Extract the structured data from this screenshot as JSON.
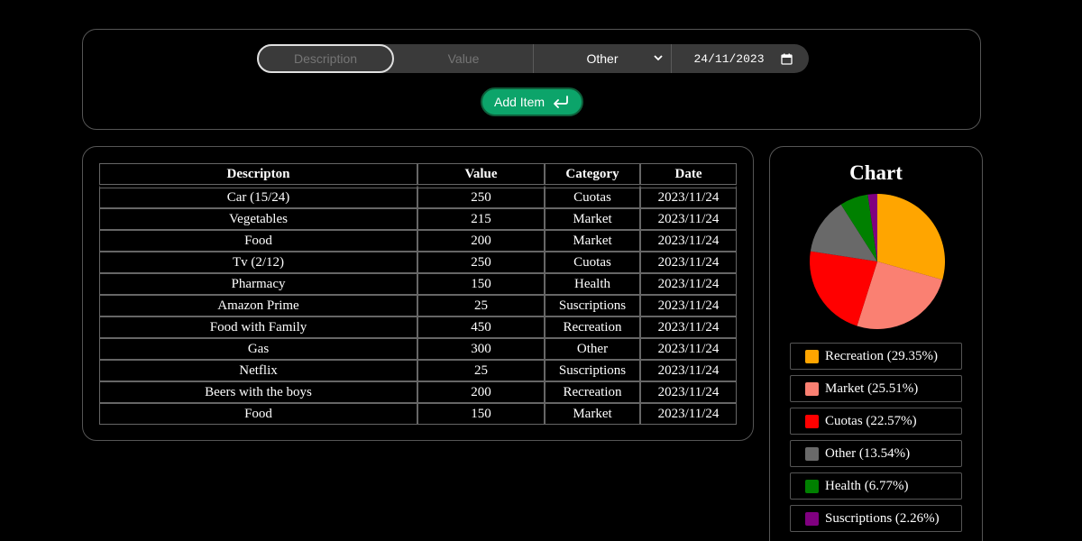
{
  "form": {
    "description_placeholder": "Description",
    "value_placeholder": "Value",
    "category_selected": "Other",
    "date_value": "24/11/2023",
    "add_button_label": "Add Item"
  },
  "table": {
    "headers": [
      "Descripton",
      "Value",
      "Category",
      "Date"
    ],
    "rows": [
      [
        "Car (15/24)",
        "250",
        "Cuotas",
        "2023/11/24"
      ],
      [
        "Vegetables",
        "215",
        "Market",
        "2023/11/24"
      ],
      [
        "Food",
        "200",
        "Market",
        "2023/11/24"
      ],
      [
        "Tv (2/12)",
        "250",
        "Cuotas",
        "2023/11/24"
      ],
      [
        "Pharmacy",
        "150",
        "Health",
        "2023/11/24"
      ],
      [
        "Amazon Prime",
        "25",
        "Suscriptions",
        "2023/11/24"
      ],
      [
        "Food with Family",
        "450",
        "Recreation",
        "2023/11/24"
      ],
      [
        "Gas",
        "300",
        "Other",
        "2023/11/24"
      ],
      [
        "Netflix",
        "25",
        "Suscriptions",
        "2023/11/24"
      ],
      [
        "Beers with the boys",
        "200",
        "Recreation",
        "2023/11/24"
      ],
      [
        "Food",
        "150",
        "Market",
        "2023/11/24"
      ]
    ]
  },
  "chart": {
    "title": "Chart"
  },
  "chart_data": {
    "type": "pie",
    "title": "Chart",
    "slices": [
      {
        "label": "Recreation",
        "value": 29.35,
        "color": "#ffa500"
      },
      {
        "label": "Market",
        "value": 25.51,
        "color": "#fa8072"
      },
      {
        "label": "Cuotas",
        "value": 22.57,
        "color": "#ff0000"
      },
      {
        "label": "Other",
        "value": 13.54,
        "color": "#696969"
      },
      {
        "label": "Health",
        "value": 6.77,
        "color": "#008000"
      },
      {
        "label": "Suscriptions",
        "value": 2.26,
        "color": "#800080"
      }
    ],
    "legend": [
      "Recreation (29.35%)",
      "Market (25.51%)",
      "Cuotas (22.57%)",
      "Other (13.54%)",
      "Health (6.77%)",
      "Suscriptions (2.26%)"
    ]
  }
}
